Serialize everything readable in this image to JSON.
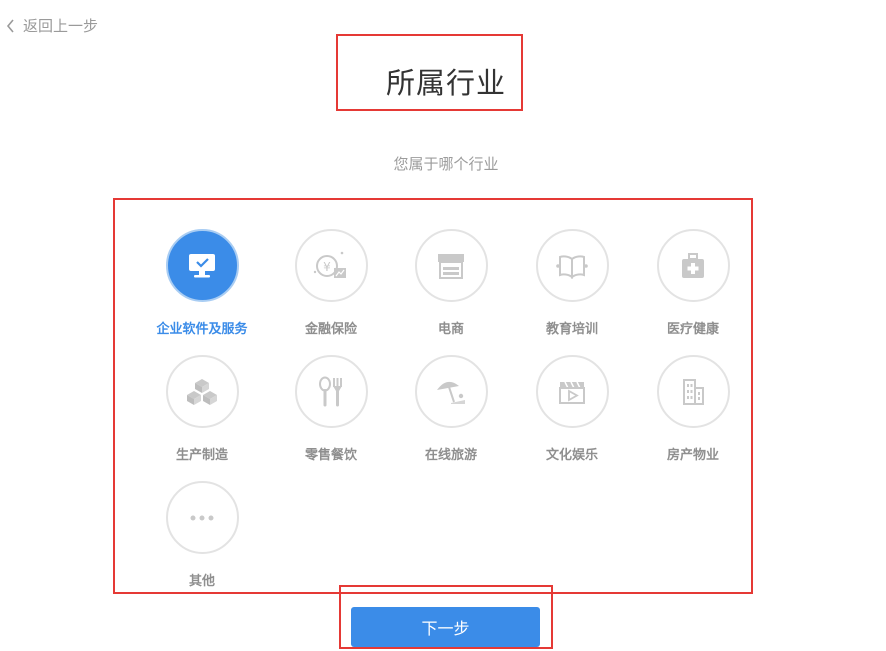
{
  "header": {
    "back_label": "返回上一步",
    "title": "所属行业",
    "subtitle": "您属于哪个行业"
  },
  "industries": [
    {
      "label": "企业软件及服务",
      "icon": "monitor-check-icon",
      "selected": true
    },
    {
      "label": "金融保险",
      "icon": "finance-coin-icon",
      "selected": false
    },
    {
      "label": "电商",
      "icon": "storefront-icon",
      "selected": false
    },
    {
      "label": "教育培训",
      "icon": "open-book-icon",
      "selected": false
    },
    {
      "label": "医疗健康",
      "icon": "medical-kit-icon",
      "selected": false
    },
    {
      "label": "生产制造",
      "icon": "stacked-boxes-icon",
      "selected": false
    },
    {
      "label": "零售餐饮",
      "icon": "spoon-fork-icon",
      "selected": false
    },
    {
      "label": "在线旅游",
      "icon": "beach-umbrella-icon",
      "selected": false
    },
    {
      "label": "文化娱乐",
      "icon": "video-clapper-icon",
      "selected": false
    },
    {
      "label": "房产物业",
      "icon": "building-icon",
      "selected": false
    },
    {
      "label": "其他",
      "icon": "more-dots-icon",
      "selected": false
    }
  ],
  "footer": {
    "next_label": "下一步"
  },
  "colors": {
    "accent": "#3b8ce8",
    "highlight_box": "#e53935",
    "muted_text": "#9c9c9c",
    "icon_gray": "#c9c9c9"
  }
}
